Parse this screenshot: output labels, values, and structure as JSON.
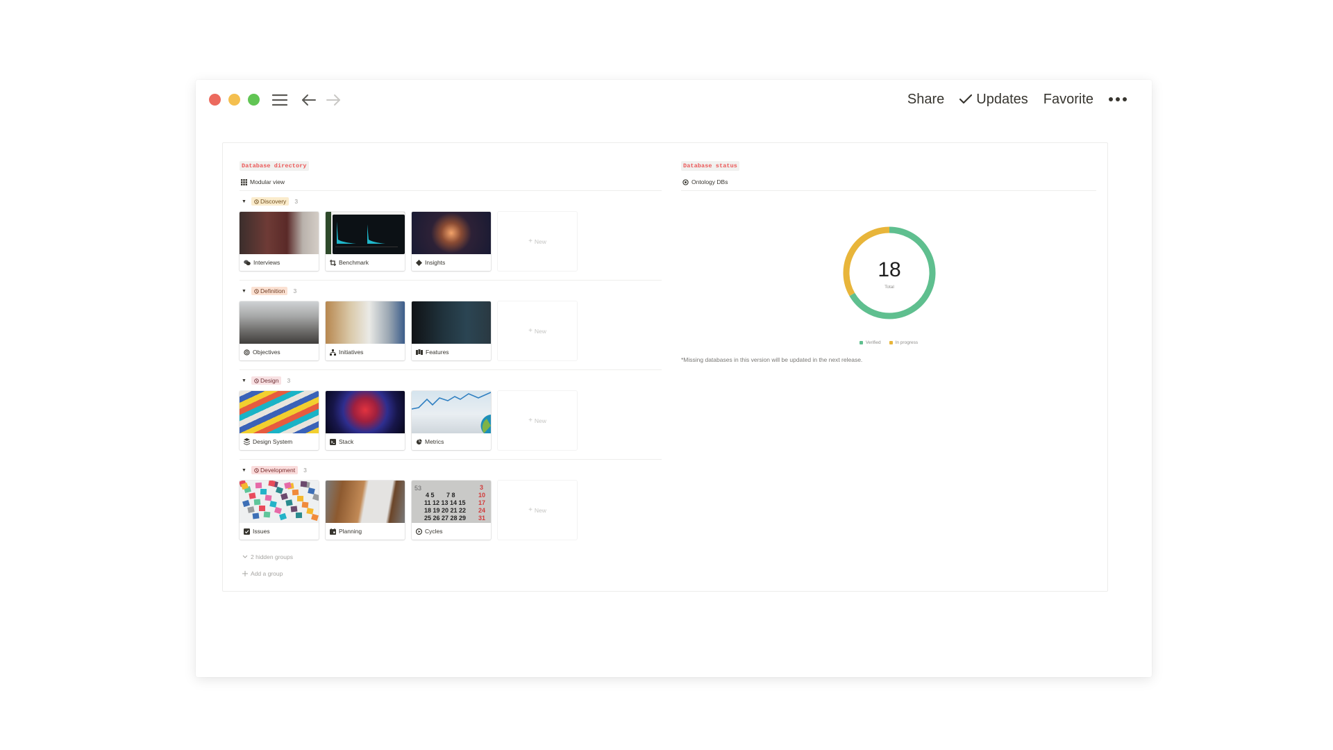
{
  "window": {
    "controls": [
      "close",
      "minimize",
      "zoom"
    ],
    "toolbar": {
      "share_label": "Share",
      "updates_label": "Updates",
      "favorite_label": "Favorite",
      "more_icon": "more-horizontal-icon"
    }
  },
  "left": {
    "section_tag": "Database directory",
    "view_label": "Modular view",
    "view_icon": "grid-icon",
    "groups": [
      {
        "name": "Discovery",
        "count": "3",
        "tag_bg": "#fbeccc",
        "tag_color": "#6f4e1f",
        "cards": [
          {
            "label": "Interviews",
            "icon": "chat-bubbles-icon"
          },
          {
            "label": "Benchmark",
            "icon": "crop-icon"
          },
          {
            "label": "Insights",
            "icon": "diamond-icon"
          }
        ],
        "new_label": "New"
      },
      {
        "name": "Definition",
        "count": "3",
        "tag_bg": "#fbe1d2",
        "tag_color": "#73422a",
        "cards": [
          {
            "label": "Objectives",
            "icon": "target-icon"
          },
          {
            "label": "Initiatives",
            "icon": "hierarchy-icon"
          },
          {
            "label": "Features",
            "icon": "map-icon"
          }
        ],
        "new_label": "New"
      },
      {
        "name": "Design",
        "count": "3",
        "tag_bg": "#f8e1e3",
        "tag_color": "#6e3036",
        "cards": [
          {
            "label": "Design System",
            "icon": "layers-icon"
          },
          {
            "label": "Stack",
            "icon": "terminal-icon"
          },
          {
            "label": "Metrics",
            "icon": "pie-chart-icon"
          }
        ],
        "new_label": "New"
      },
      {
        "name": "Development",
        "count": "3",
        "tag_bg": "#fadcdc",
        "tag_color": "#7a2e2e",
        "cards": [
          {
            "label": "Issues",
            "icon": "checkbox-icon"
          },
          {
            "label": "Planning",
            "icon": "calendar-icon"
          },
          {
            "label": "Cycles",
            "icon": "play-circle-icon"
          }
        ],
        "new_label": "New"
      }
    ],
    "hidden_groups_label": "2 hidden groups",
    "add_group_label": "Add a group"
  },
  "right": {
    "section_tag": "Database status",
    "view_label": "Ontology DBs",
    "view_icon": "target-icon",
    "note": "*Missing databases in this version will be updated in the next release."
  },
  "chart_data": {
    "type": "pie",
    "variant": "donut",
    "title": "",
    "center_value": "18",
    "center_label": "Total",
    "categories": [
      "Verified",
      "In progress"
    ],
    "values": [
      12,
      6
    ],
    "colors": [
      "#5fbf8f",
      "#e8b53a"
    ],
    "legend_position": "bottom-center"
  }
}
